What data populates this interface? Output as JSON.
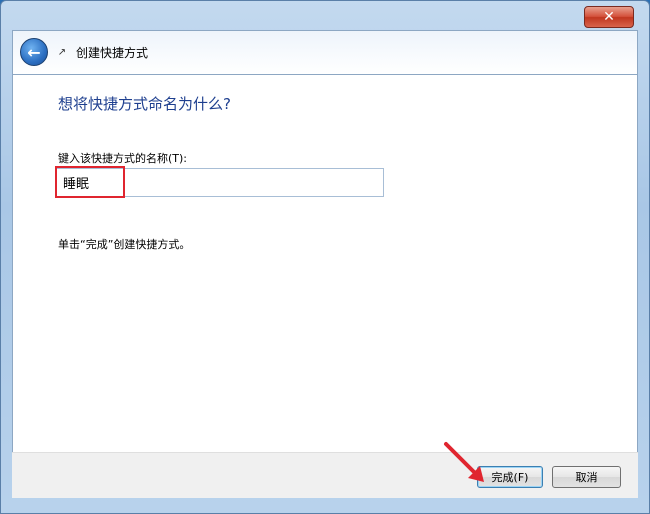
{
  "window": {
    "title": "创建快捷方式",
    "close_glyph": "✕"
  },
  "nav": {
    "back_glyph": "←",
    "shortcut_glyph": "↗"
  },
  "page": {
    "heading": "想将快捷方式命名为什么?",
    "field_label": "键入该快捷方式的名称(T):",
    "name_value": "睡眠",
    "hint": "单击“完成”创建快捷方式。"
  },
  "buttons": {
    "finish_label": "完成(F)",
    "cancel_label": "取消"
  },
  "annotations": {
    "highlight_color": "#e0252f",
    "arrow_color": "#e0252f"
  }
}
